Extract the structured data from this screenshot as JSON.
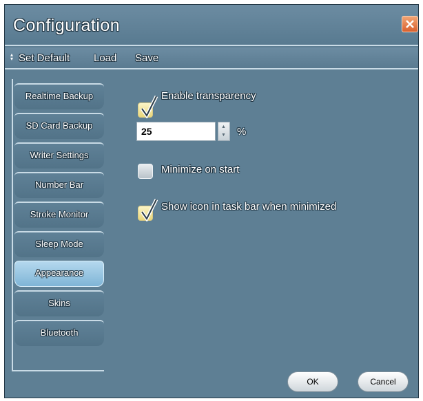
{
  "window": {
    "title": "Configuration"
  },
  "menu": {
    "items": [
      "Set Default",
      "Load",
      "Save"
    ]
  },
  "sidebar": {
    "items": [
      "Realtime Backup",
      "SD Card Backup",
      "Writer Settings",
      "Number Bar",
      "Stroke Monitor",
      "Sleep Mode",
      "Appearance",
      "Skins",
      "Bluetooth"
    ],
    "active": "Appearance"
  },
  "options": {
    "enable_transparency": {
      "label": "Enable transparency",
      "checked": true
    },
    "transparency": {
      "value": "25",
      "unit": "%"
    },
    "minimize_on_start": {
      "label": "Minimize on start",
      "checked": false
    },
    "show_icon": {
      "label": "Show icon in task bar when minimized",
      "checked": true
    }
  },
  "buttons": {
    "ok": "OK",
    "cancel": "Cancel"
  },
  "colors": {
    "background": "#5e7f94",
    "active_tab": "#9fcbe6",
    "check": "#e9d77a",
    "close": "#d9602e"
  },
  "icons": [
    "close-icon",
    "checkmark-icon",
    "spin-up-icon",
    "spin-down-icon",
    "grip-icon"
  ]
}
